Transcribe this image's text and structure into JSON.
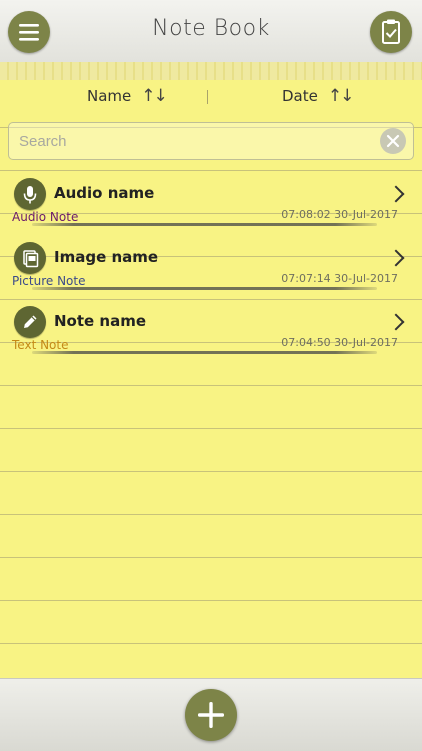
{
  "header": {
    "title": "Note Book",
    "menu_icon": "menu-icon",
    "clipboard_icon": "clipboard-check-icon"
  },
  "sortbar": {
    "name_label": "Name",
    "date_label": "Date",
    "sort_icon": "sort-arrows-icon"
  },
  "search": {
    "placeholder": "Search",
    "value": "",
    "clear_icon": "close-icon"
  },
  "notes": [
    {
      "title": "Audio name",
      "type": "Audio Note",
      "type_color": "#6b1a6b",
      "timestamp": "07:08:02 30-Jul-2017",
      "icon": "microphone-icon"
    },
    {
      "title": "Image name",
      "type": "Picture Note",
      "type_color": "#3b4a8a",
      "timestamp": "07:07:14 30-Jul-2017",
      "icon": "image-icon"
    },
    {
      "title": "Note name",
      "type": "Text Note",
      "type_color": "#c48a17",
      "timestamp": "07:04:50 30-Jul-2017",
      "icon": "pencil-icon"
    }
  ],
  "footer": {
    "add_icon": "plus-icon"
  },
  "colors": {
    "accent": "#7d8448",
    "paper": "#f8f384"
  }
}
